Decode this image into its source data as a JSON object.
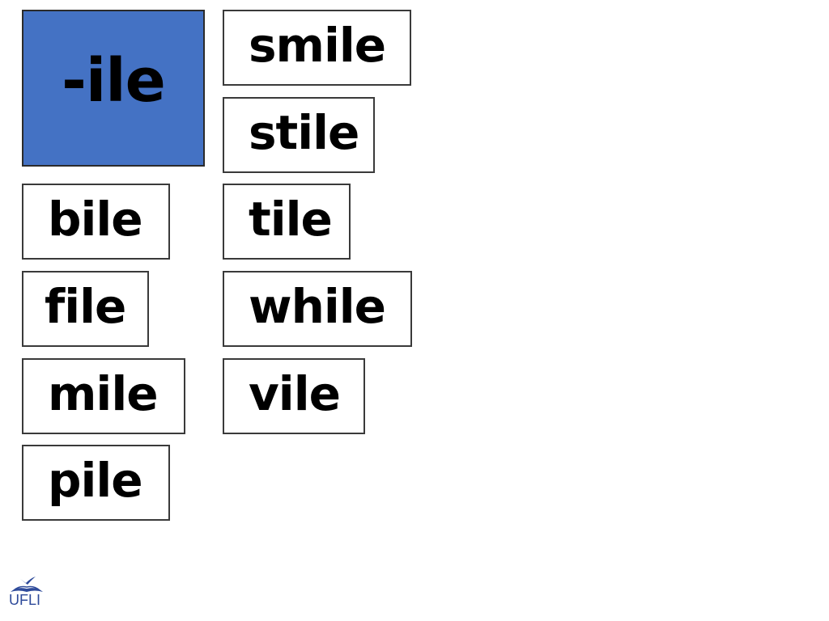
{
  "slide": {
    "header_card": {
      "text": "-ile",
      "background_color": "#4472c4"
    },
    "word_cards": [
      {
        "word": "smile"
      },
      {
        "word": "stile"
      },
      {
        "word": "bile"
      },
      {
        "word": "tile"
      },
      {
        "word": "file"
      },
      {
        "word": "while"
      },
      {
        "word": "mile"
      },
      {
        "word": "vile"
      },
      {
        "word": "pile"
      }
    ],
    "logo": {
      "text": "UFLI",
      "icon": "open-book-with-bird-icon",
      "color": "#2e4a9a"
    }
  }
}
